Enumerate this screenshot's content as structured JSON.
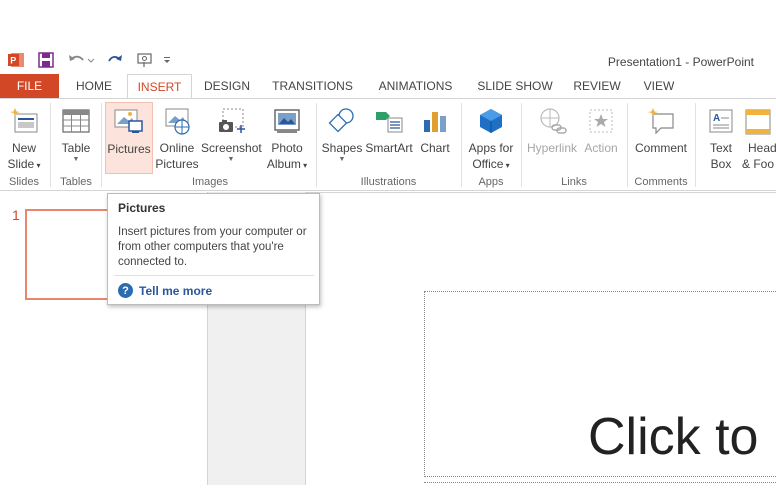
{
  "app": {
    "title": "Presentation1 - PowerPoint"
  },
  "qat": {
    "icons": [
      "powerpoint-logo-icon",
      "save-icon",
      "undo-icon",
      "redo-icon",
      "touch-mode-icon",
      "customize-qat-icon"
    ]
  },
  "tabs": [
    "FILE",
    "HOME",
    "INSERT",
    "DESIGN",
    "TRANSITIONS",
    "ANIMATIONS",
    "SLIDE SHOW",
    "REVIEW",
    "VIEW"
  ],
  "ribbon": {
    "buttons": {
      "new_slide": [
        "New",
        "Slide"
      ],
      "table": "Table",
      "pictures": "Pictures",
      "online_pictures": [
        "Online",
        "Pictures"
      ],
      "screenshot": "Screenshot",
      "photo_album": [
        "Photo",
        "Album"
      ],
      "shapes": "Shapes",
      "smartart": "SmartArt",
      "chart": "Chart",
      "apps_for_office": [
        "Apps for",
        "Office"
      ],
      "hyperlink": "Hyperlink",
      "action": "Action",
      "comment": "Comment",
      "text_box": [
        "Text",
        "Box"
      ],
      "header_footer": [
        "Head",
        "& Foo"
      ]
    },
    "groups": [
      "Slides",
      "Tables",
      "Images",
      "Illustrations",
      "Apps",
      "Links",
      "Comments"
    ]
  },
  "tooltip": {
    "title": "Pictures",
    "description": "Insert pictures from your computer or from other computers that you're connected to.",
    "help_link": "Tell me more",
    "help_glyph": "?"
  },
  "slides": {
    "number": "1",
    "title_placeholder": "Click to"
  },
  "colors": {
    "accent": "#d24726",
    "link": "#2b579a"
  }
}
